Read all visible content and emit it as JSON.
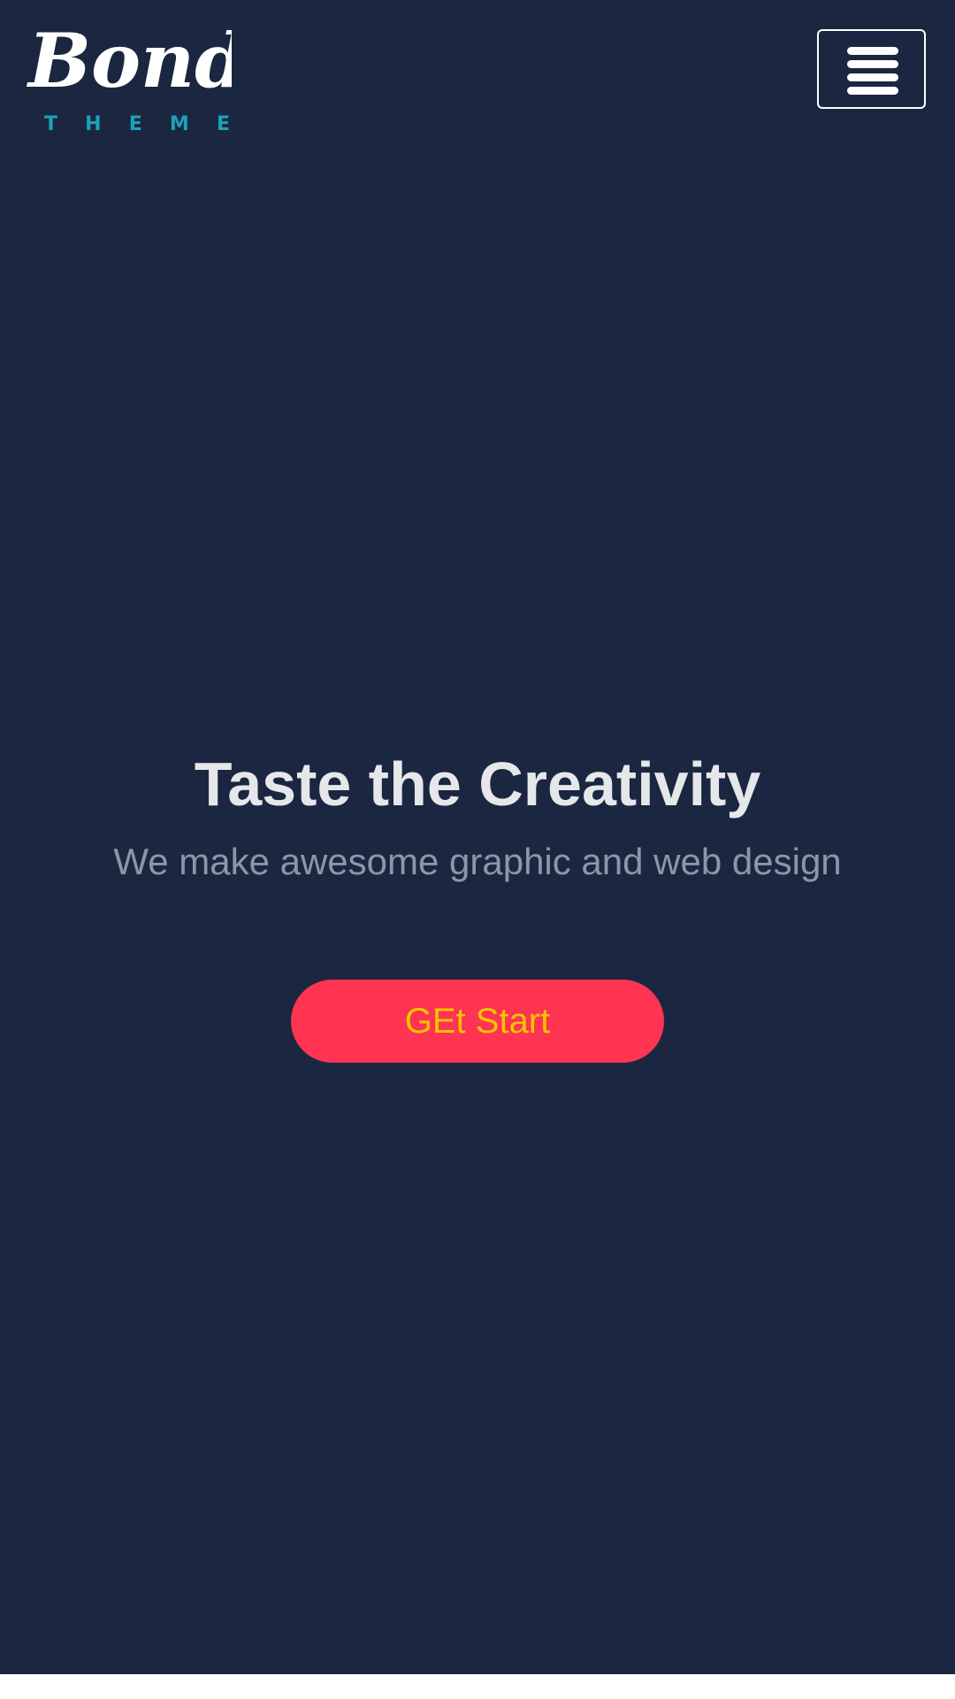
{
  "header": {
    "logo": {
      "wordmark": "Bondi",
      "subtitle_letters": [
        "T",
        "H",
        "E",
        "M",
        "E"
      ]
    },
    "menu_button": {
      "icon": "hamburger-menu-icon"
    }
  },
  "hero": {
    "title": "Taste the Creativity",
    "subtitle": "We make awesome graphic and web design",
    "cta_label": "GEt Start"
  },
  "colors": {
    "background": "#1b2740",
    "accent_button": "#ff3352",
    "button_text": "#f5c400",
    "logo_subtitle": "#1aa3b8",
    "title_text": "#e6e7ea",
    "subtitle_text": "#8e96a6"
  }
}
